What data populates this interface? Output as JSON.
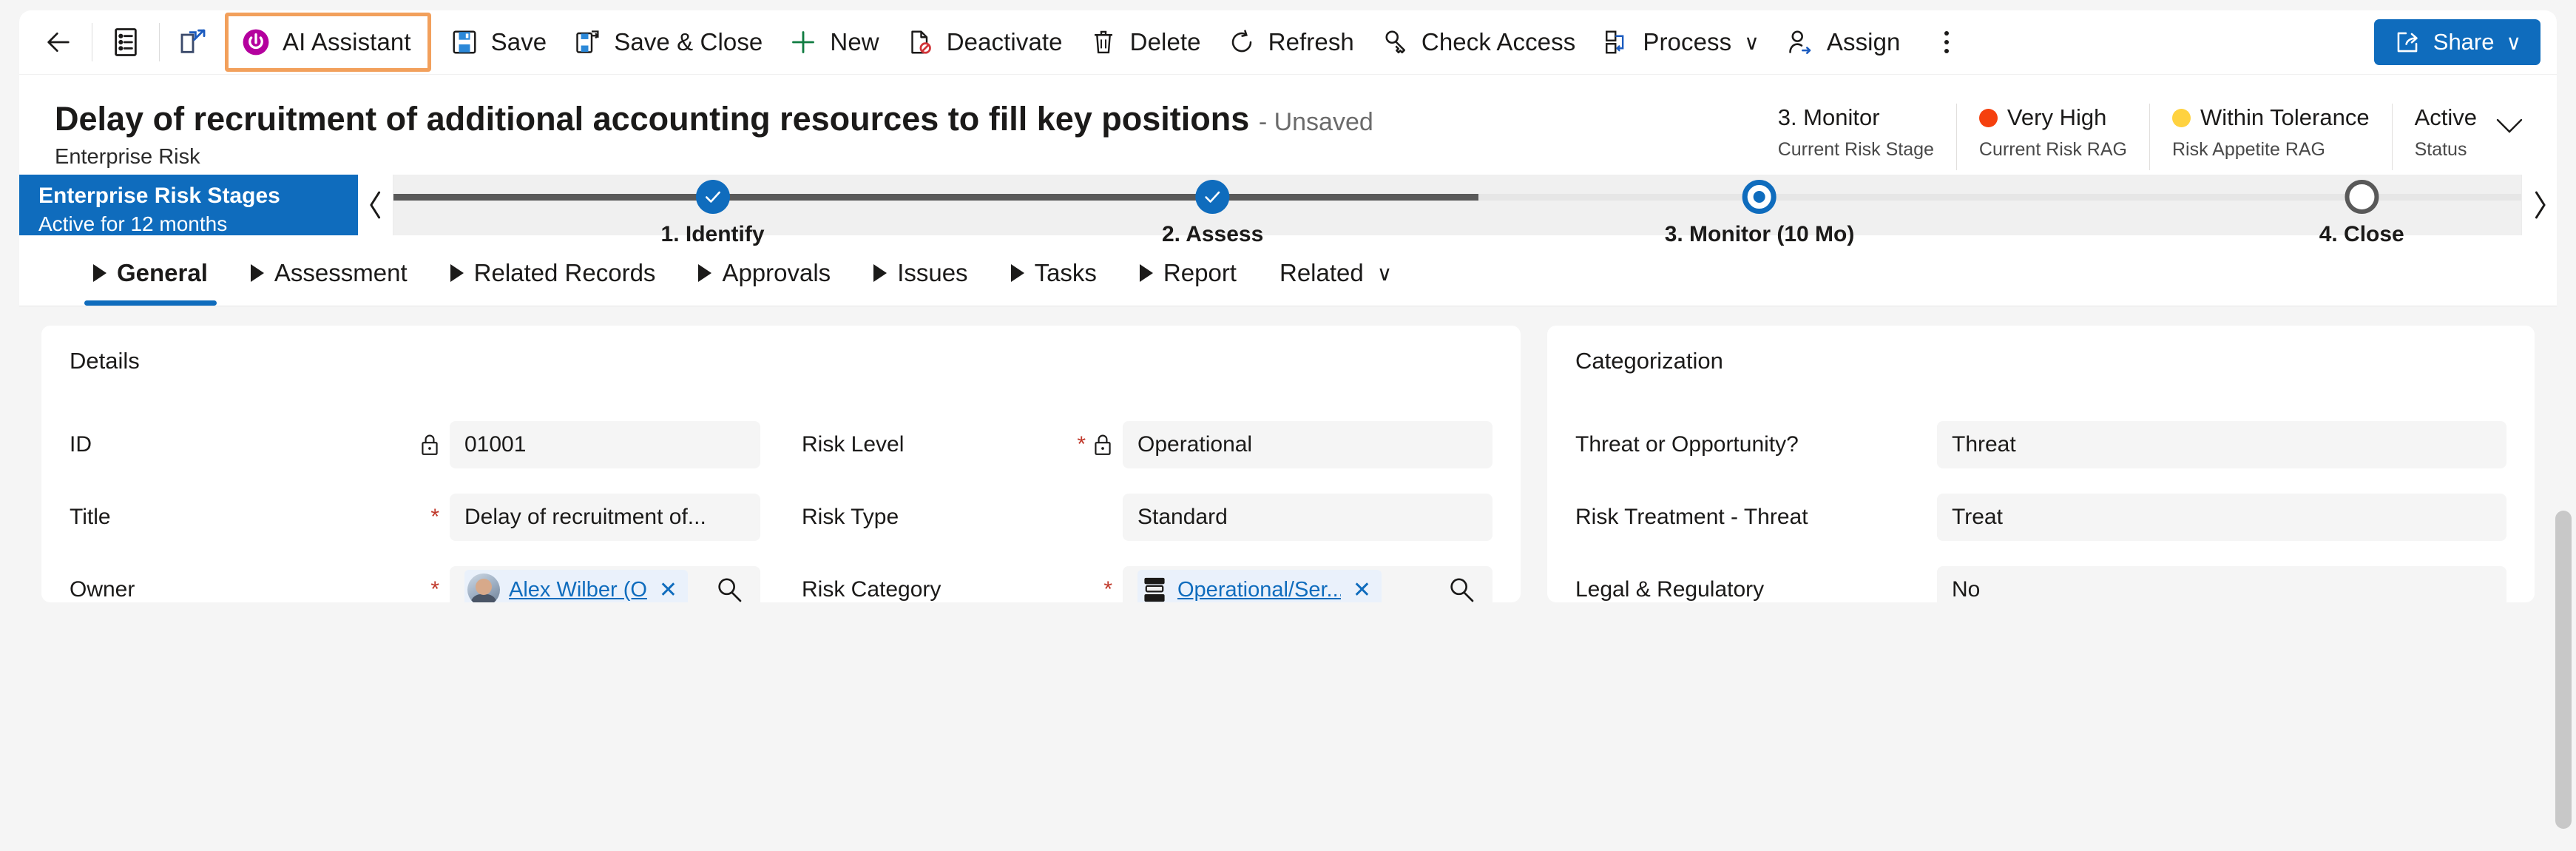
{
  "commandbar": {
    "back_tooltip": "Back",
    "form_selector_tooltip": "Form selector",
    "popout_tooltip": "Open in new window",
    "items": [
      {
        "id": "ai-assistant",
        "label": "AI Assistant",
        "icon": "ai-assistant-icon",
        "highlighted": true
      },
      {
        "id": "save",
        "label": "Save",
        "icon": "save-icon"
      },
      {
        "id": "save-close",
        "label": "Save & Close",
        "icon": "save-and-close-icon"
      },
      {
        "id": "new",
        "label": "New",
        "icon": "plus-icon"
      },
      {
        "id": "deactivate",
        "label": "Deactivate",
        "icon": "deactivate-icon"
      },
      {
        "id": "delete",
        "label": "Delete",
        "icon": "trash-icon"
      },
      {
        "id": "refresh",
        "label": "Refresh",
        "icon": "refresh-icon"
      },
      {
        "id": "check-access",
        "label": "Check Access",
        "icon": "key-icon"
      },
      {
        "id": "process",
        "label": "Process",
        "icon": "process-icon",
        "has_chevron": true
      },
      {
        "id": "assign",
        "label": "Assign",
        "icon": "assign-person-icon"
      }
    ],
    "overflow_label": "More commands",
    "share_label": "Share",
    "highlight_color": "#f2a05c",
    "accent_color": "#0f6cbd"
  },
  "record": {
    "title": "Delay of recruitment of additional accounting resources to fill key positions",
    "title_suffix": "- Unsaved",
    "subtitle": "Enterprise Risk",
    "header_fields": [
      {
        "value": "3. Monitor",
        "label": "Current Risk Stage"
      },
      {
        "value": "Very High",
        "label": "Current Risk RAG",
        "dot_color": "#f5400e"
      },
      {
        "value": "Within Tolerance",
        "label": "Risk Appetite RAG",
        "dot_color": "#ffd23f"
      },
      {
        "value": "Active",
        "label": "Status"
      }
    ]
  },
  "bpf": {
    "name": "Enterprise Risk Stages",
    "active_for": "Active for 12 months",
    "prev_label": "Previous stage",
    "next_label": "Next stage",
    "stages": [
      {
        "label": "1. Identify",
        "state": "done"
      },
      {
        "label": "2. Assess",
        "state": "done"
      },
      {
        "label": "3. Monitor  (10 Mo)",
        "state": "current"
      },
      {
        "label": "4. Close",
        "state": "todo"
      }
    ]
  },
  "tabs": {
    "items": [
      {
        "label": "General",
        "active": true,
        "expandable": true
      },
      {
        "label": "Assessment",
        "active": false,
        "expandable": true
      },
      {
        "label": "Related Records",
        "active": false,
        "expandable": true
      },
      {
        "label": "Approvals",
        "active": false,
        "expandable": true
      },
      {
        "label": "Issues",
        "active": false,
        "expandable": true
      },
      {
        "label": "Tasks",
        "active": false,
        "expandable": true
      },
      {
        "label": "Report",
        "active": false,
        "expandable": true
      }
    ],
    "related_label": "Related"
  },
  "details": {
    "section_title": "Details",
    "left": [
      {
        "label": "ID",
        "value": "01001",
        "required": false,
        "locked": true,
        "type": "text"
      },
      {
        "label": "Title",
        "value": "Delay of recruitment of...",
        "required": true,
        "locked": false,
        "type": "text"
      },
      {
        "label": "Owner",
        "value": "Alex Wilber (O",
        "required": true,
        "locked": false,
        "type": "lookup-person"
      }
    ],
    "middle": [
      {
        "label": "Risk Level",
        "value": "Operational",
        "required": true,
        "locked": true,
        "type": "text"
      },
      {
        "label": "Risk Type",
        "value": "Standard",
        "required": false,
        "locked": false,
        "type": "text"
      },
      {
        "label": "Risk Category",
        "value": "Operational/Ser...",
        "required": true,
        "locked": false,
        "type": "lookup-entity"
      }
    ]
  },
  "categorization": {
    "section_title": "Categorization",
    "fields": [
      {
        "label": "Threat or Opportunity?",
        "value": "Threat"
      },
      {
        "label": "Risk Treatment - Threat",
        "value": "Treat"
      },
      {
        "label": "Legal & Regulatory",
        "value": "No"
      }
    ]
  }
}
